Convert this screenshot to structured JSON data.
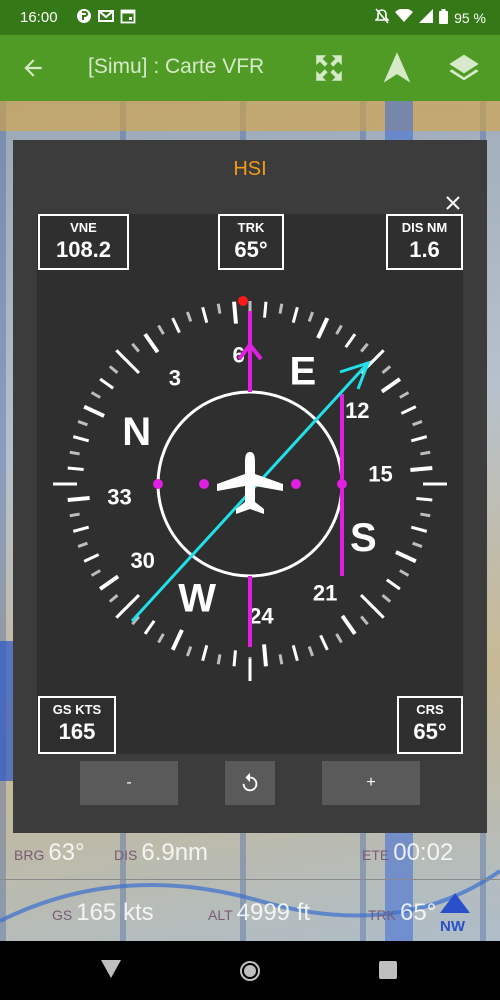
{
  "status": {
    "time": "16:00",
    "battery": "95 %",
    "icons": [
      "app-icon",
      "gmail-icon",
      "calendar-icon"
    ]
  },
  "appbar": {
    "title": "[Simu] : Carte VFR"
  },
  "dialog": {
    "title": "HSI",
    "boxes": {
      "vne": {
        "label": "VNE",
        "value": "108.2"
      },
      "trk": {
        "label": "TRK",
        "value": "65°"
      },
      "dis": {
        "label": "DIS NM",
        "value": "1.6"
      },
      "gs": {
        "label": "GS KTS",
        "value": "165"
      },
      "crs": {
        "label": "CRS",
        "value": "65°"
      }
    },
    "compass": {
      "heading_deg": 65,
      "course_deg": 65,
      "labels": [
        "N",
        "3",
        "6",
        "E",
        "12",
        "15",
        "S",
        "21",
        "24",
        "W",
        "30",
        "33"
      ]
    },
    "controls": {
      "minus": "-",
      "plus": "+"
    }
  },
  "bottom": {
    "brg_label": "BRG",
    "brg_value": "63°",
    "dis_label": "DIS",
    "dis_value": "6.9nm",
    "ete_label": "ETE",
    "ete_value": "00:02",
    "gs_label": "GS",
    "gs_value": "165 kts",
    "alt_label": "ALT",
    "alt_value": "4999 ft",
    "trk_label": "TRK",
    "trk_value": "65°",
    "nw_label": "NW"
  },
  "colors": {
    "accent": "#f39a1a",
    "magenta": "#e020e0",
    "cyan": "#22e0e8",
    "appbar": "#4f9b26",
    "statusbar": "#347818"
  }
}
